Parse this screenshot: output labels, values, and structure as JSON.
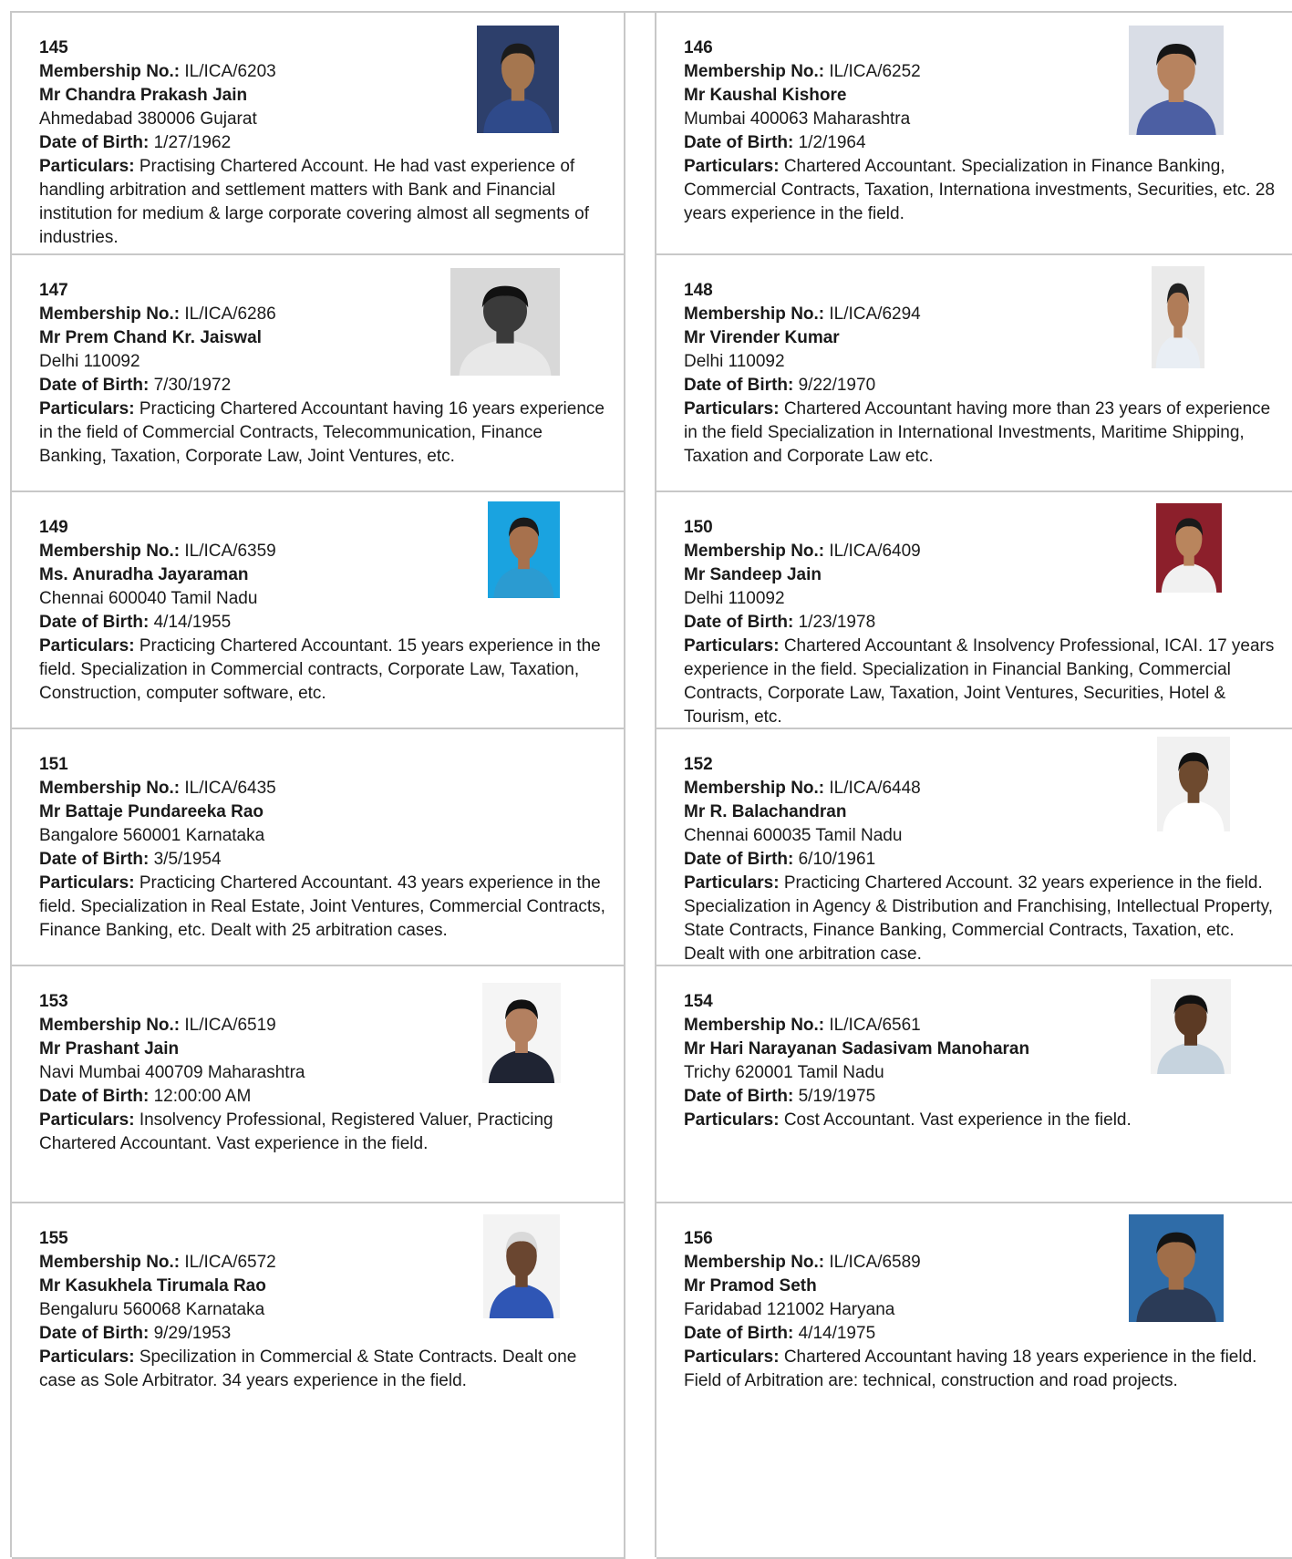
{
  "labels": {
    "membership": "Membership No.:",
    "dob": "Date of Birth:",
    "particulars": "Particulars:"
  },
  "members": [
    {
      "num": "145",
      "membership_no": "IL/ICA/6203",
      "name": "Mr Chandra Prakash Jain",
      "location": "Ahmedabad 380006 Gujarat",
      "dob": "1/27/1962",
      "particulars": "Practising Chartered Account. He had vast experience of handling arbitration and settlement matters with Bank and Financial institution for medium & large corporate covering almost all segments of industries."
    },
    {
      "num": "146",
      "membership_no": "IL/ICA/6252",
      "name": "Mr Kaushal Kishore",
      "location": "Mumbai 400063 Maharashtra",
      "dob": "1/2/1964",
      "particulars": "Chartered Accountant. Specialization in Finance Banking, Commercial Contracts, Taxation, Internationa investments, Securities, etc. 28 years experience in the field."
    },
    {
      "num": "147",
      "membership_no": "IL/ICA/6286",
      "name": "Mr Prem Chand Kr. Jaiswal",
      "location": "Delhi 110092",
      "dob": "7/30/1972",
      "particulars": "Practicing Chartered Accountant having 16 years experience in the field of Commercial Contracts, Telecommunication, Finance Banking, Taxation, Corporate Law, Joint Ventures, etc."
    },
    {
      "num": "148",
      "membership_no": "IL/ICA/6294",
      "name": "Mr Virender Kumar",
      "location": "Delhi 110092",
      "dob": "9/22/1970",
      "particulars": "Chartered Accountant having more than 23 years of experience in the field Specialization in International Investments, Maritime Shipping, Taxation and Corporate Law etc."
    },
    {
      "num": "149",
      "membership_no": "IL/ICA/6359",
      "name": "Ms. Anuradha Jayaraman",
      "location": "Chennai 600040 Tamil Nadu",
      "dob": "4/14/1955",
      "particulars": "Practicing Chartered Accountant. 15 years experience in the field. Specialization in Commercial contracts, Corporate Law, Taxation, Construction, computer software, etc."
    },
    {
      "num": "150",
      "membership_no": "IL/ICA/6409",
      "name": "Mr Sandeep Jain",
      "location": "Delhi 110092",
      "dob": "1/23/1978",
      "particulars": "Chartered Accountant & Insolvency Professional, ICAI. 17 years experience in the field. Specialization in Financial Banking, Commercial Contracts, Corporate Law, Taxation, Joint Ventures, Securities, Hotel & Tourism, etc."
    },
    {
      "num": "151",
      "membership_no": "IL/ICA/6435",
      "name": "Mr Battaje Pundareeka Rao",
      "location": "Bangalore 560001 Karnataka",
      "dob": "3/5/1954",
      "particulars": "Practicing Chartered Accountant. 43 years experience in the field. Specialization in Real Estate, Joint Ventures, Commercial Contracts, Finance Banking, etc. Dealt with 25 arbitration cases."
    },
    {
      "num": "152",
      "membership_no": "IL/ICA/6448",
      "name": "Mr R. Balachandran",
      "location": "Chennai 600035 Tamil Nadu",
      "dob": "6/10/1961",
      "particulars": "Practicing Chartered Account. 32 years experience in the field. Specialization in Agency & Distribution and Franchising, Intellectual Property, State Contracts, Finance Banking, Commercial Contracts, Taxation, etc. Dealt with one arbitration case."
    },
    {
      "num": "153",
      "membership_no": "IL/ICA/6519",
      "name": "Mr Prashant Jain",
      "location": "Navi Mumbai 400709 Maharashtra",
      "dob": "12:00:00 AM",
      "particulars": "Insolvency Professional, Registered Valuer, Practicing Chartered Accountant. Vast experience in the field."
    },
    {
      "num": "154",
      "membership_no": "IL/ICA/6561",
      "name": "Mr Hari Narayanan Sadasivam Manoharan",
      "location": "Trichy 620001 Tamil Nadu",
      "dob": "5/19/1975",
      "particulars": "Cost Accountant. Vast experience in the field."
    },
    {
      "num": "155",
      "membership_no": "IL/ICA/6572",
      "name": "Mr Kasukhela Tirumala Rao",
      "location": "Bengaluru 560068 Karnataka",
      "dob": "9/29/1953",
      "particulars": "Specilization in Commercial & State Contracts. Dealt one case as Sole Arbitrator. 34 years experience in the field."
    },
    {
      "num": "156",
      "membership_no": "IL/ICA/6589",
      "name": "Mr Pramod Seth",
      "location": "Faridabad 121002 Haryana",
      "dob": "4/14/1975",
      "particulars": "Chartered Accountant having 18 years experience in the field. Field of Arbitration are: technical, construction and road projects."
    }
  ]
}
